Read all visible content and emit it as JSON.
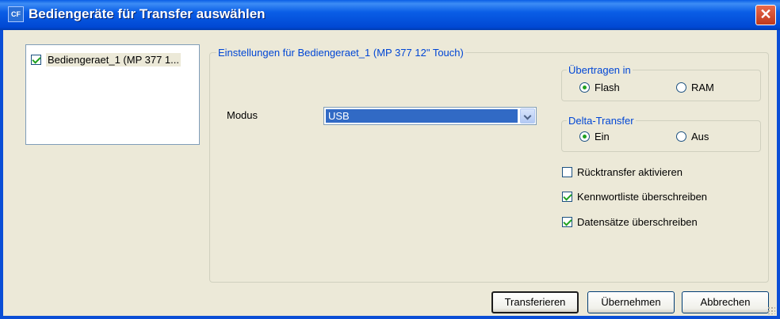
{
  "window": {
    "title": "Bediengeräte für Transfer auswählen",
    "icon_text": "CF",
    "icon": "app-icon",
    "close_icon": "close-icon"
  },
  "device_list": {
    "items": [
      {
        "label": "Bediengeraet_1 (MP 377 1...",
        "checked": true
      }
    ]
  },
  "settings": {
    "group_title": "Einstellungen für Bediengeraet_1 (MP 377 12\" Touch)",
    "modus_label": "Modus",
    "modus_value": "USB",
    "uebertragen": {
      "title": "Übertragen in",
      "options": [
        "Flash",
        "RAM"
      ],
      "selected": "Flash"
    },
    "delta": {
      "title": "Delta-Transfer",
      "options": [
        "Ein",
        "Aus"
      ],
      "selected": "Ein"
    },
    "checkboxes": [
      {
        "label": "Rücktransfer aktivieren",
        "checked": false
      },
      {
        "label": "Kennwortliste überschreiben",
        "checked": true
      },
      {
        "label": "Datensätze überschreiben",
        "checked": true
      }
    ]
  },
  "buttons": {
    "transfer": "Transferieren",
    "apply": "Übernehmen",
    "cancel": "Abbrechen"
  },
  "colors": {
    "titlebar": "#0a5ee6",
    "group_title": "#0046d5",
    "selection": "#316ac5",
    "check": "#21a121",
    "close": "#c0391c"
  }
}
